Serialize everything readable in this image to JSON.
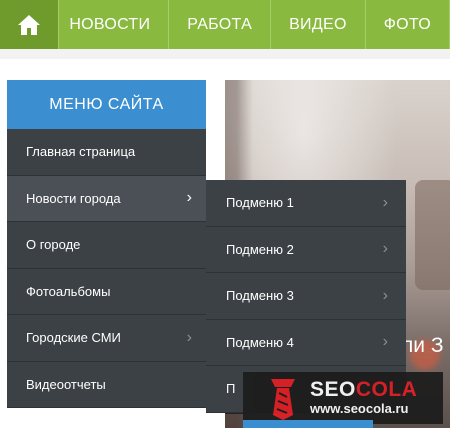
{
  "topnav": {
    "home_icon": "home-icon",
    "items": [
      "НОВОСТИ",
      "РАБОТА",
      "ВИДЕО",
      "ФОТО"
    ]
  },
  "sidebar": {
    "title": "МЕНЮ САЙТА",
    "items": [
      {
        "label": "Главная страница",
        "has_submenu": false
      },
      {
        "label": "Новости города",
        "has_submenu": true,
        "active": true
      },
      {
        "label": "О городе",
        "has_submenu": false
      },
      {
        "label": "Фотоальбомы",
        "has_submenu": false
      },
      {
        "label": "Городские СМИ",
        "has_submenu": true
      },
      {
        "label": "Видеоотчеты",
        "has_submenu": false
      }
    ]
  },
  "submenu": {
    "items": [
      "Подменю 1",
      "Подменю 2",
      "Подменю 3",
      "Подменю 4",
      "П"
    ]
  },
  "hero": {
    "caption": "ли З"
  },
  "watermark": {
    "brand_a": "SEO",
    "brand_b": "COLA",
    "url": "www.seocola.ru"
  },
  "colors": {
    "nav_green": "#8ab93f",
    "menu_header_blue": "#3b8fd0",
    "menu_bg": "#3b4145"
  }
}
